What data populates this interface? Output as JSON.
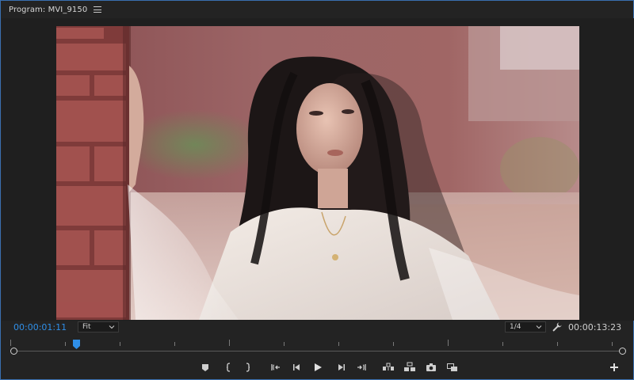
{
  "panel": {
    "title": "Program: MVI_9150",
    "menu_icon": "hamburger-menu-icon"
  },
  "viewer": {
    "content": "video-frame"
  },
  "controls": {
    "current_timecode": "00:00:01:11",
    "duration_timecode": "00:00:13:23",
    "zoom_level": "Fit",
    "playback_resolution": "1/4",
    "settings_icon": "wrench-icon"
  },
  "timeline": {
    "playhead_position": 0.103,
    "in_point": 0,
    "out_point": 1
  },
  "transport": {
    "buttons": [
      "add-marker-icon",
      "mark-in-icon",
      "mark-out-icon",
      "go-to-in-icon",
      "step-back-icon",
      "play-icon",
      "step-forward-icon",
      "go-to-out-icon",
      "lift-icon",
      "extract-icon",
      "export-frame-icon",
      "comparison-view-icon",
      "button-editor-icon"
    ]
  },
  "colors": {
    "panel_bg": "#232323",
    "accent": "#2f8fe8",
    "panel_border": "#3a6fb0"
  }
}
